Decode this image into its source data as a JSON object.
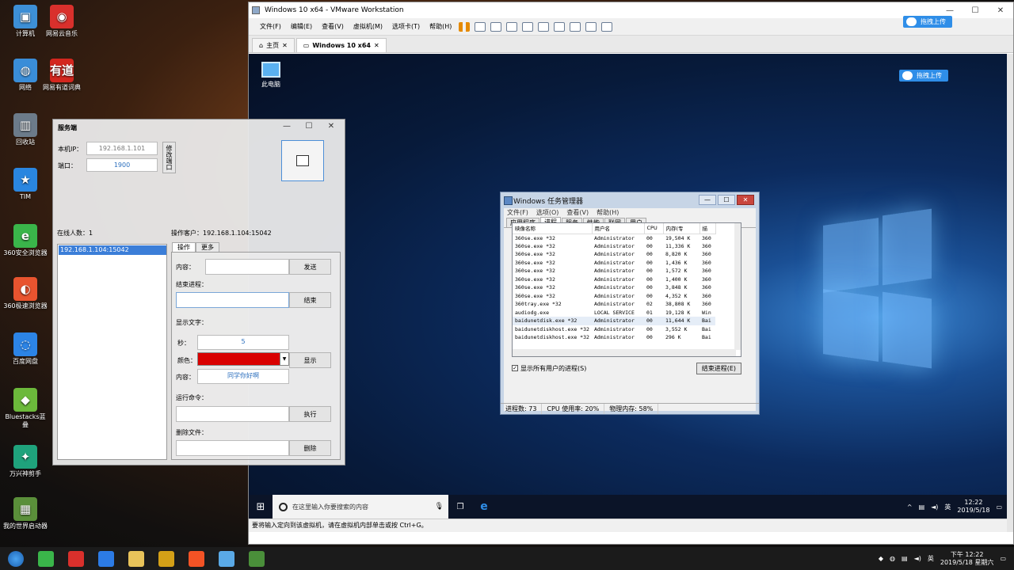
{
  "host_desktop_icons": [
    {
      "label": "计算机",
      "color": "#3d8fd6",
      "glyph": "▣"
    },
    {
      "label": "网易云音乐",
      "color": "#d9302c",
      "glyph": "◉"
    },
    {
      "label": "网络",
      "color": "#3a8dd8",
      "glyph": "◍"
    },
    {
      "label": "网易有道词典",
      "color": "#d3261e",
      "glyph": "有道"
    },
    {
      "label": "回收站",
      "color": "#6c7b8a",
      "glyph": "▥"
    },
    {
      "label": "TIM",
      "color": "#2a86e0",
      "glyph": "★"
    },
    {
      "label": "360安全浏览器",
      "color": "#3ab54a",
      "glyph": "e"
    },
    {
      "label": "360极速浏览器",
      "color": "#e8542f",
      "glyph": "◐"
    },
    {
      "label": "百度网盘",
      "color": "#2c84e6",
      "glyph": "◌"
    },
    {
      "label": "Bluestacks蓝叠",
      "color": "#6cb93b",
      "glyph": "◆"
    },
    {
      "label": "万兴神剪手",
      "color": "#1fa37c",
      "glyph": "✦"
    },
    {
      "label": "我的世界启动器",
      "color": "#5a8f3a",
      "glyph": "▦"
    }
  ],
  "vmware": {
    "title": "Windows 10 x64 - VMware Workstation",
    "menu": [
      "文件(F)",
      "编辑(E)",
      "查看(V)",
      "虚拟机(M)",
      "选项卡(T)",
      "帮助(H)"
    ],
    "tabs": [
      {
        "label": "主页"
      },
      {
        "label": "Windows 10 x64"
      }
    ],
    "upload_label": "拖拽上传",
    "statusbar": "要将输入定向到该虚拟机，请在虚拟机内部单击或按 Ctrl+G。",
    "guest_desktop_icon": "此电脑",
    "guest_search_placeholder": "在这里输入你要搜索的内容",
    "guest_clock_time": "12:22",
    "guest_clock_date": "2019/5/18",
    "guest_ime": "英"
  },
  "taskmgr": {
    "title": "Windows 任务管理器",
    "menu": [
      "文件(F)",
      "选项(O)",
      "查看(V)",
      "帮助(H)"
    ],
    "tabs": [
      "应用程序",
      "进程",
      "服务",
      "性能",
      "联网",
      "用户"
    ],
    "columns": [
      "映像名称",
      "用户名",
      "CPU",
      "内存(专",
      "描"
    ],
    "rows": [
      [
        "360se.exe *32",
        "Administrator",
        "00",
        "19,504 K",
        "360"
      ],
      [
        "360se.exe *32",
        "Administrator",
        "00",
        "11,336 K",
        "360"
      ],
      [
        "360se.exe *32",
        "Administrator",
        "00",
        "8,820 K",
        "360"
      ],
      [
        "360se.exe *32",
        "Administrator",
        "00",
        "1,436 K",
        "360"
      ],
      [
        "360se.exe *32",
        "Administrator",
        "00",
        "1,572 K",
        "360"
      ],
      [
        "360se.exe *32",
        "Administrator",
        "00",
        "1,400 K",
        "360"
      ],
      [
        "360se.exe *32",
        "Administrator",
        "00",
        "3,848 K",
        "360"
      ],
      [
        "360se.exe *32",
        "Administrator",
        "00",
        "4,352 K",
        "360"
      ],
      [
        "360tray.exe *32",
        "Administrator",
        "02",
        "38,808 K",
        "360"
      ],
      [
        "audiodg.exe",
        "LOCAL SERVICE",
        "01",
        "19,128 K",
        "Win"
      ],
      [
        "baidunetdisk.exe *32",
        "Administrator",
        "00",
        "11,644 K",
        "Bai"
      ],
      [
        "baidunetdiskhost.exe *32",
        "Administrator",
        "00",
        "3,552 K",
        "Bai"
      ],
      [
        "baidunetdiskhost.exe *32",
        "Administrator",
        "00",
        "296 K",
        "Bai"
      ]
    ],
    "show_all_label": "显示所有用户的进程(S)",
    "end_process_label": "结束进程(E)",
    "status": [
      "进程数: 73",
      "CPU 使用率: 20%",
      "物理内存: 58%"
    ]
  },
  "server": {
    "title": "服务端",
    "ip_label": "本机IP：",
    "ip_value": "192.168.1.101",
    "port_label": "端口：",
    "port_value": "1900",
    "change_port_label": "修改端口",
    "online_label": "在线人数：1",
    "client_list": [
      "192.168.1.104:15042"
    ],
    "operating_label": "操作客户：192.168.1.104:15042",
    "tabs": [
      "操作",
      "更多"
    ],
    "content_label": "内容：",
    "send_label": "发送",
    "end_process_label": "结束进程：",
    "end_label": "结束",
    "show_text_label": "显示文字：",
    "seconds_label": "秒：",
    "seconds_value": "5",
    "color_label": "颜色：",
    "color_value": "#d90000",
    "text_label": "内容：",
    "text_value": "同学你好啊",
    "show_label": "显示",
    "run_cmd_label": "运行命令：",
    "exec_label": "执行",
    "delete_file_label": "删除文件：",
    "delete_label": "删除"
  },
  "host_taskbar": {
    "apps": [
      {
        "name": "360-browser",
        "color": "#3ab54a"
      },
      {
        "name": "netease-music",
        "color": "#d9302c"
      },
      {
        "name": "google-chrome",
        "color": "#2c7be5"
      },
      {
        "name": "file-explorer",
        "color": "#e8c35a"
      },
      {
        "name": "vmware-app",
        "color": "#d4a017"
      },
      {
        "name": "microsoft-store",
        "color": "#f35325"
      },
      {
        "name": "baidu-netdisk",
        "color": "#5aa9e6"
      },
      {
        "name": "server-app",
        "color": "#4a8f3a"
      }
    ],
    "ime": "英",
    "time": "下午 12:22",
    "date": "2019/5/18 星期六"
  }
}
